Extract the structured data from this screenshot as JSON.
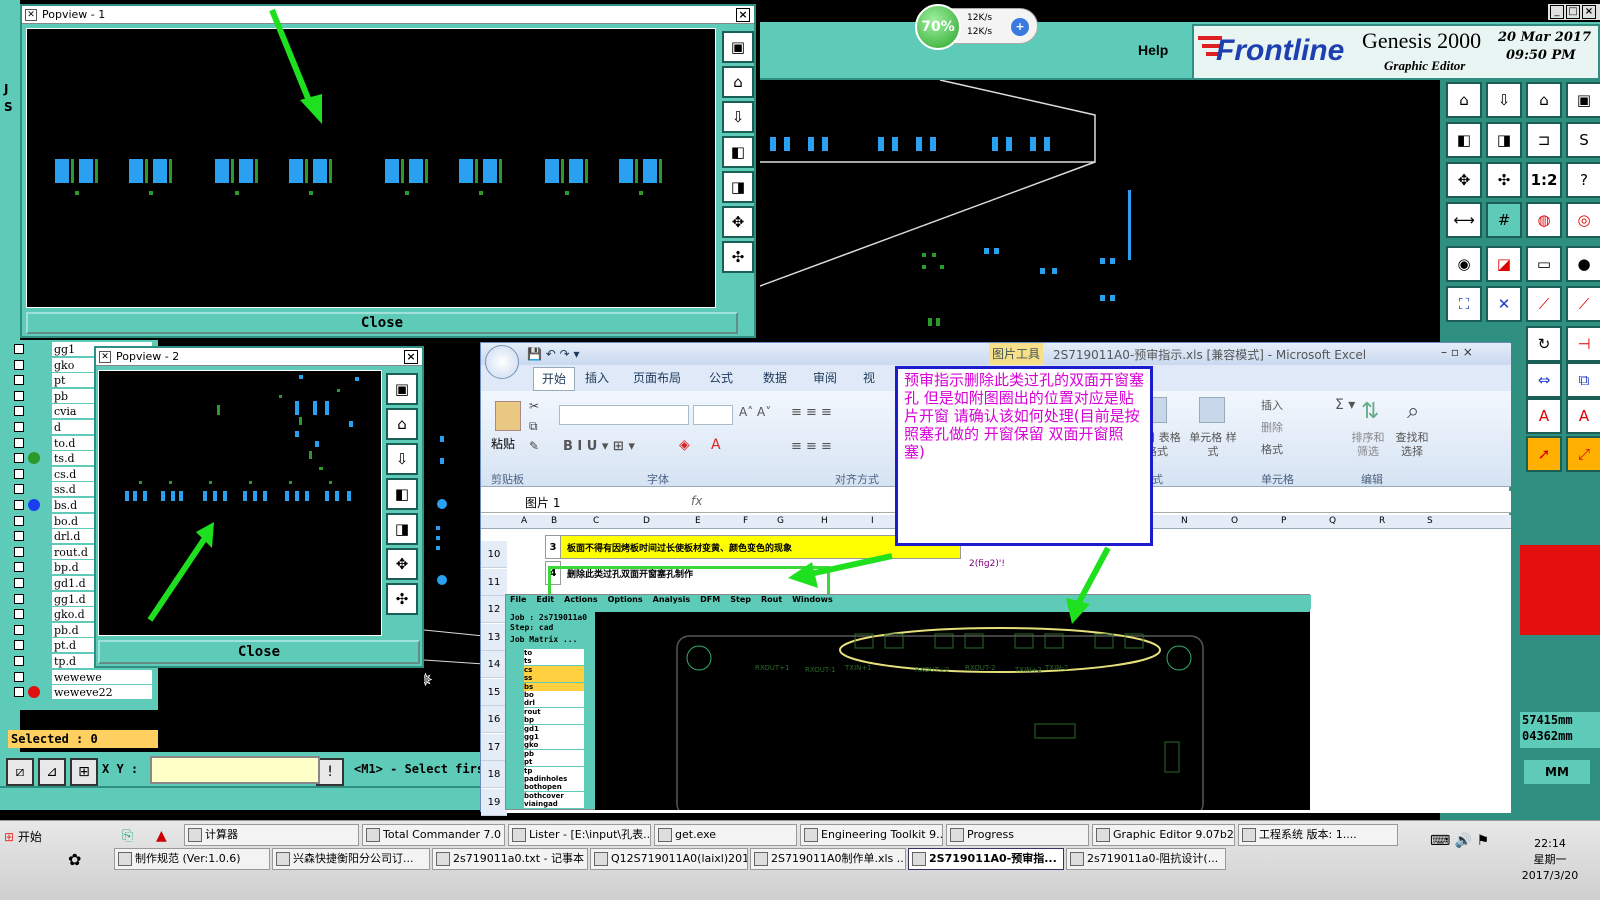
{
  "genesis": {
    "help_label": "Help",
    "brand": "Frontline",
    "product": "Genesis 2000",
    "subtitle": "Graphic Editor",
    "date": "20 Mar 2017",
    "time": "09:50 PM",
    "coords": {
      "x": "57415mm",
      "y": "04362mm"
    },
    "units_button": "MM",
    "selected_label": "Selected : 0",
    "xy_label": "X Y :",
    "status_msg": "<M1> - Select firs",
    "left_letters": [
      "J",
      "S"
    ]
  },
  "layers": [
    {
      "name": "gg1",
      "dot": ""
    },
    {
      "name": "gko",
      "dot": ""
    },
    {
      "name": "pt",
      "dot": ""
    },
    {
      "name": "pb",
      "dot": ""
    },
    {
      "name": "cvia",
      "dot": ""
    },
    {
      "name": "d",
      "dot": ""
    },
    {
      "name": "to.d",
      "dot": ""
    },
    {
      "name": "ts.d",
      "dot": "#2a9a2a"
    },
    {
      "name": "cs.d",
      "dot": ""
    },
    {
      "name": "ss.d",
      "dot": ""
    },
    {
      "name": "bs.d",
      "dot": "#1a3ef0"
    },
    {
      "name": "bo.d",
      "dot": ""
    },
    {
      "name": "drl.d",
      "dot": ""
    },
    {
      "name": "rout.d",
      "dot": ""
    },
    {
      "name": "bp.d",
      "dot": ""
    },
    {
      "name": "gd1.d",
      "dot": ""
    },
    {
      "name": "gg1.d",
      "dot": ""
    },
    {
      "name": "gko.d",
      "dot": ""
    },
    {
      "name": "pb.d",
      "dot": ""
    },
    {
      "name": "pt.d",
      "dot": ""
    },
    {
      "name": "tp.d",
      "dot": ""
    },
    {
      "name": "wewewe",
      "dot": ""
    },
    {
      "name": "weweve22",
      "dot": "#e01010"
    }
  ],
  "popview1": {
    "title": "Popview - 1",
    "close_label": "Close"
  },
  "popview2": {
    "title": "Popview - 2",
    "close_label": "Close"
  },
  "speed": {
    "percent": "70%",
    "up": "12K/s",
    "down": "12K/s"
  },
  "excel": {
    "title": "2S719011A0-预审指示.xls [兼容模式] - Microsoft Excel",
    "context_tab": "图片工具",
    "tabs": [
      "开始",
      "插入",
      "页面布局",
      "公式",
      "数据",
      "审阅",
      "视"
    ],
    "groups": [
      "剪贴板",
      "字体",
      "对齐方式",
      "样式",
      "单元格",
      "编辑"
    ],
    "ribbon_labels": {
      "paste": "粘贴",
      "insert": "插入",
      "delete": "删除",
      "format": "格式",
      "table_format": "套用 表格格式",
      "cell_style": "单元格 样式",
      "sort": "排序和 筛选",
      "find": "查找和 选择"
    },
    "name_box": "图片 1",
    "fx": "fx",
    "columns": [
      "A",
      "B",
      "C",
      "D",
      "E",
      "F",
      "G",
      "H",
      "I",
      "J",
      "K",
      "L",
      "M",
      "N",
      "O",
      "P",
      "Q",
      "R",
      "S"
    ],
    "rows": [
      "10",
      "11",
      "12",
      "13",
      "14",
      "15",
      "16",
      "17",
      "18",
      "19"
    ],
    "cell_row3_no": "3",
    "cell_row3_text": "板面不得有因烤板时间过长使板材变黄、颜色变色的现象",
    "cell_row4_no": "4",
    "cell_row4_text": "删除此类过孔双面开窗塞孔制作",
    "cell_fig": "2(fig2)'!"
  },
  "note_text": "预审指示删除此类过孔的双面开窗塞孔    但是如附图圈出的位置对应是贴片开窗    请确认该如何处理(目前是按照塞孔做的    开窗保留    双面开窗照塞)",
  "embedded": {
    "menu": [
      "File",
      "Edit",
      "Actions",
      "Options",
      "Analysis",
      "DFM",
      "Step",
      "Rout",
      "Windows"
    ],
    "job": "Job : 2s719011a0",
    "step": "Step: cad",
    "matrix": "Job Matrix ...",
    "layers": [
      "to",
      "ts",
      "cs",
      "ss",
      "bs",
      "bo",
      "drl",
      "rout",
      "bp",
      "gd1",
      "gg1",
      "gko",
      "pb",
      "pt",
      "tp",
      "padinholes",
      "bothopen",
      "bothcover",
      "viaingad"
    ],
    "pcb_labels": [
      "RXOUT+1",
      "RXOUT-1",
      "TXIN+1",
      "RXOUT+2",
      "RXOUT-2",
      "TXIN+2",
      "TXIN-2"
    ]
  },
  "taskbar": {
    "start": "开始",
    "row1": [
      "计算器",
      "Total Commander 7.0 ...",
      "Lister - [E:\\input\\孔表...",
      "get.exe",
      "Engineering Toolkit 9....",
      "Progress",
      "Graphic Editor 9.07b2 ...",
      "工程系统  版本: 1...."
    ],
    "row2": [
      "制作规范 (Ver:1.0.6)",
      "兴森快捷衡阳分公司订...",
      "2s719011a0.txt - 记事本",
      "Q12S719011A0(laixl)201...",
      "2S719011A0制作单.xls ...",
      "2S719011A0-预审指...",
      "2s719011a0-阻抗设计(..."
    ],
    "active": "2S719011A0-预审指...",
    "clock_time": "22:14",
    "clock_day": "星期一",
    "clock_date": "2017/3/20"
  },
  "colors": {
    "genesis_teal": "#5ecbb8",
    "pad_blue": "#2aa0f0",
    "arrow_green": "#1ee01e",
    "note_border": "#1c1ccc",
    "note_text": "#d800d8",
    "highlight_yellow": "#ffff00"
  }
}
